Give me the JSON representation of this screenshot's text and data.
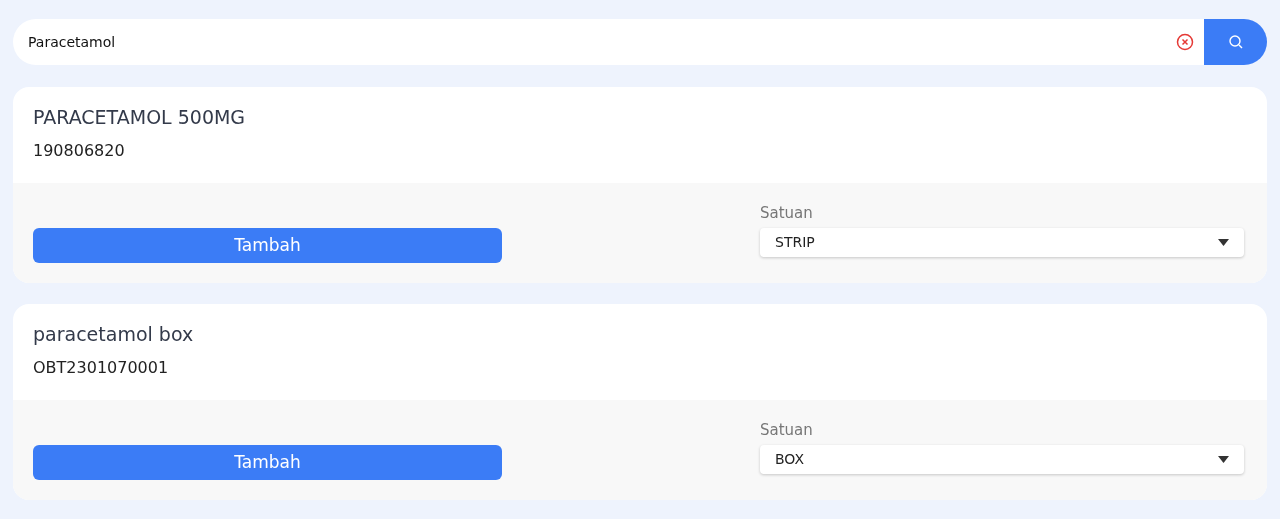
{
  "search": {
    "value": "Paracetamol"
  },
  "products": [
    {
      "name": "PARACETAMOL 500MG",
      "code": "190806820",
      "button": "Tambah",
      "unit_label": "Satuan",
      "unit": "STRIP"
    },
    {
      "name": "paracetamol box",
      "code": "OBT2301070001",
      "button": "Tambah",
      "unit_label": "Satuan",
      "unit": "BOX"
    }
  ]
}
